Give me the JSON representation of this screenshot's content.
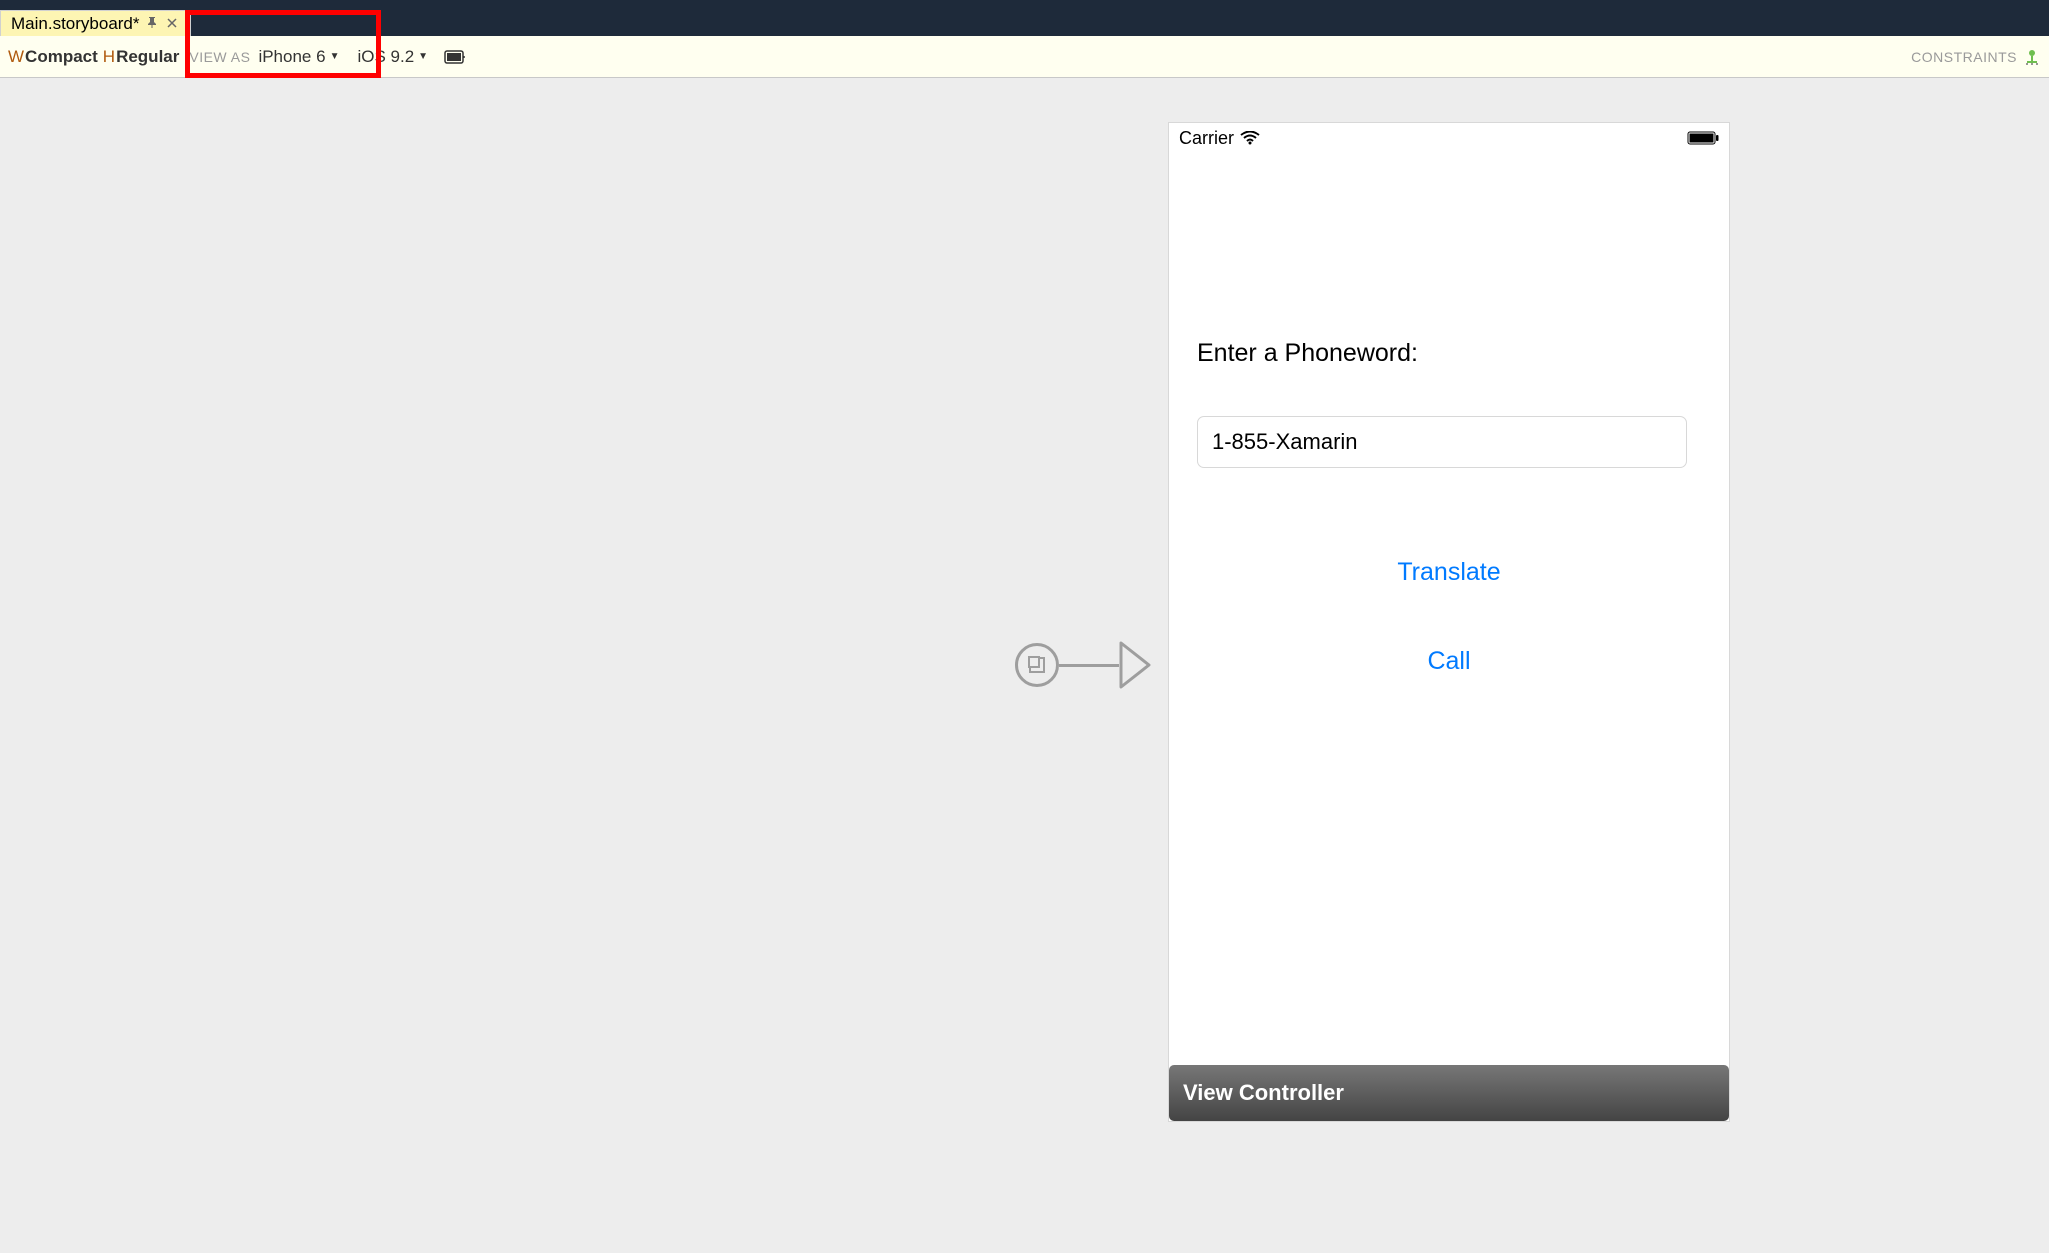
{
  "tab": {
    "title": "Main.storyboard*"
  },
  "toolbar": {
    "w_prefix": "W",
    "compact": "Compact",
    "h_prefix": "H",
    "regular": "Regular",
    "view_as_label": "VIEW AS",
    "device": "iPhone 6",
    "ios_version": "iOS 9.2",
    "constraints_label": "CONSTRAINTS"
  },
  "statusbar": {
    "carrier": "Carrier"
  },
  "app": {
    "label": "Enter a Phoneword:",
    "textfield_value": "1-855-Xamarin",
    "translate_label": "Translate",
    "call_label": "Call"
  },
  "scene": {
    "vc_name": "View Controller"
  }
}
